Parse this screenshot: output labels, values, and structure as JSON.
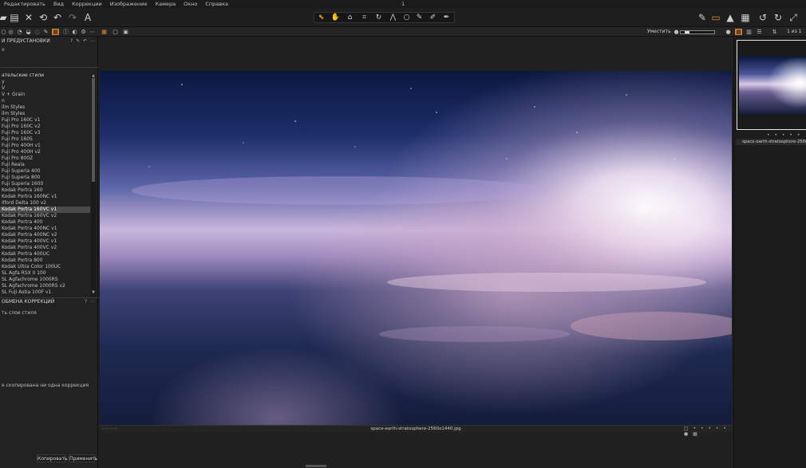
{
  "window": {
    "title": "1"
  },
  "menu": [
    "Редактировать",
    "Вид",
    "Коррекции",
    "Изображение",
    "Камера",
    "Окно",
    "Справка"
  ],
  "toolbar": {
    "left_icons": [
      "import-icon",
      "export-icon",
      "delete-icon",
      "reset-icon",
      "undo-icon",
      "redo-icon",
      "text-icon"
    ],
    "center_tools": [
      "select-cursor-icon",
      "pan-hand-icon",
      "loupe-icon",
      "crop-icon",
      "rotate-icon",
      "keystone-icon",
      "circle-mask-icon",
      "brush-icon",
      "eraser-icon",
      "picker-icon"
    ],
    "right_icons": [
      "color-picker-icon",
      "layers-icon",
      "warning-icon",
      "grid-icon",
      "rotate-left-icon",
      "rotate-right-icon",
      "fullscreen-icon"
    ]
  },
  "secbar": {
    "zoom_label": "Уместить",
    "count": "1 из 1",
    "zoom_level": 0.12
  },
  "left_panel": {
    "presets_header": "И ПРЕДУСТАНОВКИ",
    "presets_sub": "о",
    "styles_header": "ательские стили",
    "styles": [
      "y",
      "V",
      "V + Grain",
      "n",
      "ilm Styles",
      "ilm Styles",
      "Fuji Pro 160C v1",
      "Fuji Pro 160C v2",
      "Fuji Pro 160C v3",
      "Fuji Pro 160S",
      "Fuji Pro 400H v1",
      "Fuji Pro 400H v2",
      "Fuji Pro 800Z",
      "Fuji Reala",
      "Fuji Superia 400",
      "Fuji Superia 800",
      "Fuji Superia 1600",
      "Kodak Portra 160",
      "Kodak Portra 160NC v1",
      "Ilford Delta 100 v2",
      "Kodak Portra 160VC v1",
      "Kodak Portra 160VC v2",
      "Kodak Portra 400",
      "Kodak Portra 400NC v1",
      "Kodak Portra 400NC v2",
      "Kodak Portra 400VC v1",
      "Kodak Portra 400VC v2",
      "Kodak Portra 400UC",
      "Kodak Portra 800",
      "Kodak Ultra Color 100UC",
      "SL Agfa RSX II 100",
      "SL Agfachrome 1000RS",
      "SL Agfachrome 1000RS v2",
      "SL Fuji Astia 100F v1"
    ],
    "selected_style_index": 20,
    "exchange_header": "ОБМЕНА КОРРЕКЦИЙ",
    "exchange_sub": "ть слои стиля",
    "exchange_msg": "е скопирована ни одна коррекция",
    "copy_btn": "Копировать",
    "apply_btn": "Применить"
  },
  "viewer": {
    "filename": "space-earth-stratosphere-2560x1440.jpg",
    "status_left": "-- -- -- --"
  },
  "browser": {
    "thumb_name": "space-earth-stratosphere-2560x1440.jpg"
  }
}
